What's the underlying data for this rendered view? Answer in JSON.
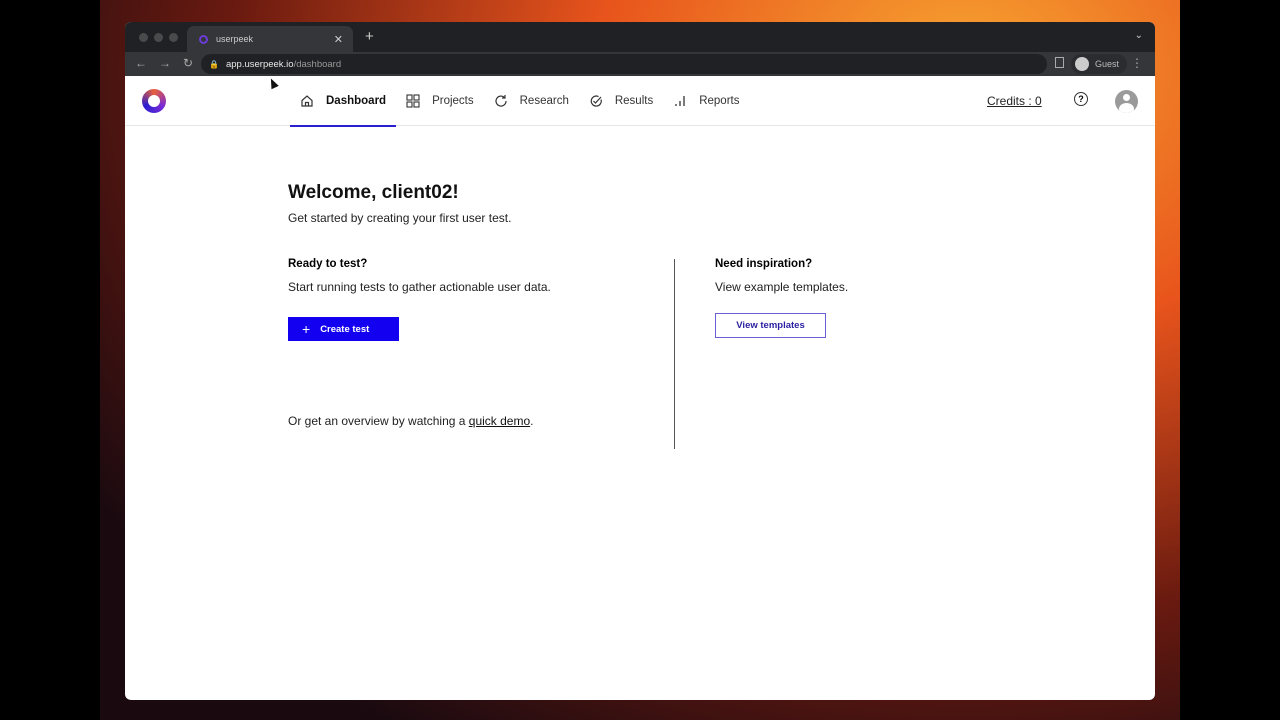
{
  "browser": {
    "tab_title": "userpeek",
    "url_host": "app.userpeek.io",
    "url_path": "/dashboard",
    "profile": "Guest"
  },
  "nav": {
    "items": [
      {
        "label": "Dashboard",
        "icon": "home-icon",
        "active": true
      },
      {
        "label": "Projects",
        "icon": "grid-icon"
      },
      {
        "label": "Research",
        "icon": "refresh-icon"
      },
      {
        "label": "Results",
        "icon": "check-circle-icon"
      },
      {
        "label": "Reports",
        "icon": "bar-chart-icon"
      }
    ],
    "credits": "Credits : 0",
    "help": "?"
  },
  "main": {
    "title": "Welcome, client02!",
    "subtitle": "Get started by creating your first user test.",
    "left": {
      "heading": "Ready to test?",
      "text": "Start running tests to gather actionable user data.",
      "button": "Create test",
      "demo_prefix": "Or get an overview by watching a ",
      "demo_link": "quick demo",
      "demo_suffix": "."
    },
    "right": {
      "heading": "Need inspiration?",
      "text": "View example templates.",
      "button": "View templates"
    }
  },
  "colors": {
    "accent": "#1400f0"
  }
}
